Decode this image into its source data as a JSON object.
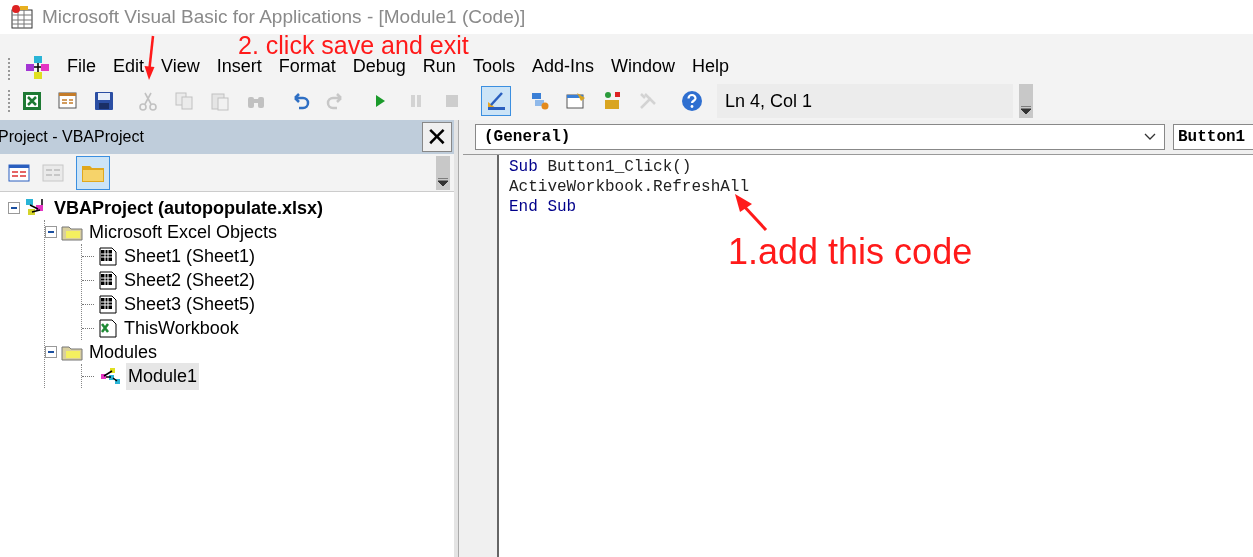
{
  "window": {
    "title": "Microsoft Visual Basic for Applications - [Module1 (Code)]"
  },
  "menu": [
    {
      "label": "File"
    },
    {
      "label": "Edit"
    },
    {
      "label": "View"
    },
    {
      "label": "Insert"
    },
    {
      "label": "Format"
    },
    {
      "label": "Debug"
    },
    {
      "label": "Run"
    },
    {
      "label": "Tools"
    },
    {
      "label": "Add-Ins"
    },
    {
      "label": "Window"
    },
    {
      "label": "Help"
    }
  ],
  "toolbar": [
    {
      "kind": "excel",
      "disabled": false,
      "selected": false
    },
    {
      "kind": "insert",
      "disabled": false,
      "selected": false
    },
    {
      "kind": "save",
      "disabled": false,
      "selected": false
    },
    {
      "kind": "cut",
      "disabled": true,
      "selected": false
    },
    {
      "kind": "copy",
      "disabled": true,
      "selected": false
    },
    {
      "kind": "paste",
      "disabled": true,
      "selected": false
    },
    {
      "kind": "find",
      "disabled": true,
      "selected": false
    },
    {
      "kind": "undo",
      "disabled": false,
      "selected": false
    },
    {
      "kind": "redo",
      "disabled": true,
      "selected": false
    },
    {
      "kind": "run",
      "disabled": false,
      "selected": false
    },
    {
      "kind": "break",
      "disabled": true,
      "selected": false
    },
    {
      "kind": "reset",
      "disabled": true,
      "selected": false
    },
    {
      "kind": "design",
      "disabled": false,
      "selected": true
    },
    {
      "kind": "explorer",
      "disabled": false,
      "selected": false
    },
    {
      "kind": "properties",
      "disabled": false,
      "selected": false
    },
    {
      "kind": "browser",
      "disabled": false,
      "selected": false
    },
    {
      "kind": "toolbox",
      "disabled": true,
      "selected": false
    },
    {
      "kind": "help",
      "disabled": false,
      "selected": false
    }
  ],
  "position": "Ln 4, Col 1",
  "project_panel": {
    "title": "Project - VBAProject",
    "close": "✕",
    "tree": [
      {
        "label": "VBAProject (autopopulate.xlsx)",
        "kind": "project",
        "selected": false,
        "expanded": true,
        "children": [
          {
            "label": "Microsoft Excel Objects",
            "kind": "folder",
            "selected": false,
            "expanded": true,
            "children": [
              {
                "label": "Sheet1 (Sheet1)",
                "kind": "sheet",
                "selected": false
              },
              {
                "label": "Sheet2 (Sheet2)",
                "kind": "sheet",
                "selected": false
              },
              {
                "label": "Sheet3 (Sheet5)",
                "kind": "sheet",
                "selected": false
              },
              {
                "label": "ThisWorkbook",
                "kind": "workbook",
                "selected": false
              }
            ]
          },
          {
            "label": "Modules",
            "kind": "folder",
            "selected": false,
            "expanded": true,
            "children": [
              {
                "label": "Module1",
                "kind": "module",
                "selected": true
              }
            ]
          }
        ]
      }
    ]
  },
  "code_window": {
    "object_dropdown": "(General)",
    "procedure_dropdown": "Button1",
    "lines": [
      [
        {
          "text": "Sub",
          "kind": "keyword"
        },
        {
          "text": " Button1_Click()",
          "kind": "plain"
        }
      ],
      [
        {
          "text": "ActiveWorkbook.RefreshAll",
          "kind": "plain"
        }
      ],
      [
        {
          "text": "End Sub",
          "kind": "keyword"
        }
      ]
    ]
  },
  "annotations": [
    {
      "text": "2. click save and exit",
      "kind": "top"
    },
    {
      "text": "1.add this code",
      "kind": "code"
    }
  ]
}
